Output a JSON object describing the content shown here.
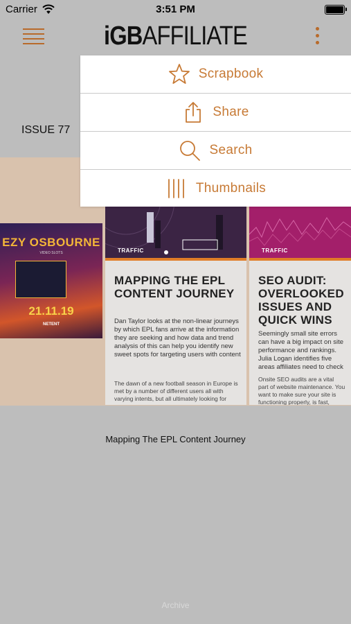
{
  "status_bar": {
    "carrier": "Carrier",
    "time": "3:51 PM"
  },
  "header": {
    "logo_prefix": "iGB",
    "logo_suffix": "AFFILIATE",
    "menu_icon": "hamburger-icon",
    "more_icon": "kebab-icon",
    "accent_color": "#c77a35"
  },
  "issue": {
    "label": "ISSUE 77"
  },
  "cover": {
    "title": "EZY OSBOURNE",
    "subtitle": "VIDEO SLOTS",
    "date": "21.11.19",
    "brand": "NETENT"
  },
  "pages": [
    {
      "tag": "TRAFFIC",
      "headline": "MAPPING THE EPL CONTENT JOURNEY",
      "standfirst": "Dan Taylor looks at the non-linear journeys by which EPL fans arrive at the information they are seeking and how data and trend analysis of this can help you identify new sweet spots for targeting users with content",
      "body": "The dawn of a new football season in Europe is met by a number of different users all with varying intents, but all ultimately looking for"
    },
    {
      "tag": "TRAFFIC",
      "headline": "SEO AUDIT: OVERLOOKED ISSUES AND QUICK WINS",
      "standfirst": "Seemingly small site errors can have a big impact on site performance and rankings. Julia Logan identifies five areas affiliates need to check",
      "body": "Onsite SEO audits are a vital part of website maintenance. You want to make sure your site is functioning properly, is fast, navigable and indexable. But smaller issues can get overlooked"
    }
  ],
  "caption": "Mapping The EPL Content Journey",
  "footer": {
    "archive_label": "Archive"
  },
  "dropdown": {
    "items": [
      {
        "label": "Scrapbook",
        "icon": "star-icon"
      },
      {
        "label": "Share",
        "icon": "share-icon"
      },
      {
        "label": "Search",
        "icon": "search-icon"
      },
      {
        "label": "Thumbnails",
        "icon": "thumbnails-icon"
      }
    ]
  }
}
